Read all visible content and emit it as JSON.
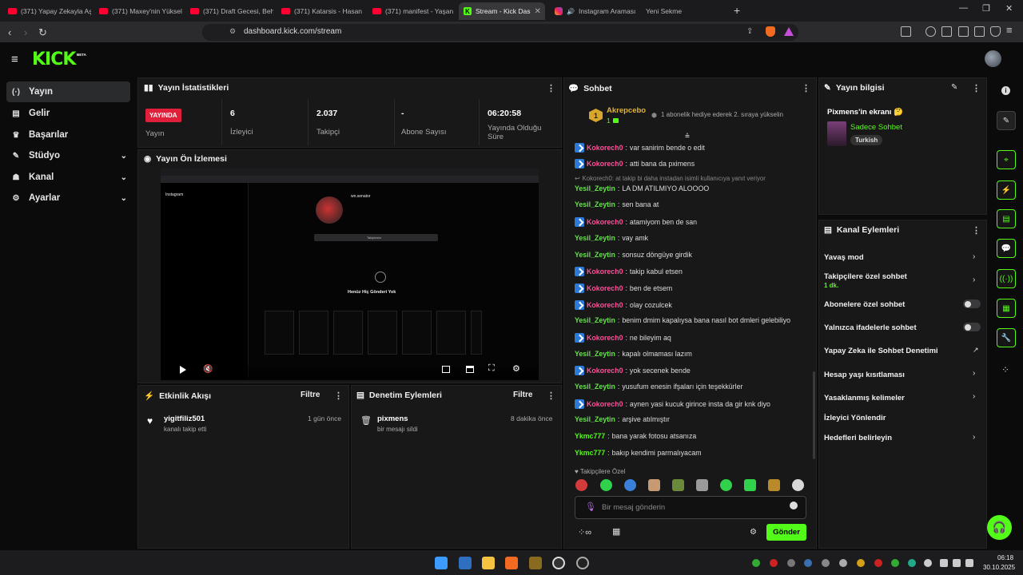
{
  "browser": {
    "tabs": [
      {
        "title": "(371) Yapay Zekayla Aş"
      },
      {
        "title": "(371) Maxey'nin Yüksel"
      },
      {
        "title": "(371) Draft Gecesi, Beh"
      },
      {
        "title": "(371) Katarsis - Hasan"
      },
      {
        "title": "(371) manifest - Yaşan"
      },
      {
        "title": "Stream - Kick Das"
      },
      {
        "title": "Instagram Araması"
      },
      {
        "title": "Yeni Sekme"
      }
    ],
    "new_tab": "+",
    "url": "dashboard.kick.com/stream"
  },
  "header": {
    "logo": "KICK",
    "beta": "BETA"
  },
  "sidebar": {
    "items": [
      {
        "label": "Yayın",
        "icon": "broadcast-icon"
      },
      {
        "label": "Gelir",
        "icon": "wallet-icon"
      },
      {
        "label": "Başarılar",
        "icon": "trophy-icon"
      },
      {
        "label": "Stüdyo",
        "icon": "studio-icon"
      },
      {
        "label": "Kanal",
        "icon": "user-icon"
      },
      {
        "label": "Ayarlar",
        "icon": "gear-icon"
      }
    ]
  },
  "stats": {
    "title": "Yayın İstatistikleri",
    "live_badge": "YAYINDA",
    "status_label": "Yayın",
    "viewers": "6",
    "viewers_label": "İzleyici",
    "followers": "2.037",
    "followers_label": "Takipçi",
    "subs": "-",
    "subs_label": "Abone Sayısı",
    "uptime": "06:20:58",
    "uptime_label": "Yayında Olduğu Süre"
  },
  "preview": {
    "title": "Yayın Ön İzlemesi",
    "profile_name": "wn.senator",
    "no_posts": "Henüz Hiç Gönderi Yok",
    "follow_btn": "Takiptesin",
    "ig_logo": "Instagram"
  },
  "activity": {
    "title": "Etkinlik Akışı",
    "filter": "Filtre",
    "user": "yigitfiliz501",
    "action": "kanalı takip etti",
    "time": "1 gün önce"
  },
  "moderation": {
    "title": "Denetim Eylemleri",
    "filter": "Filtre",
    "user": "pixmens",
    "action": "bir mesajı sildi",
    "time": "8 dakika önce"
  },
  "chat": {
    "title": "Sohbet",
    "gifter_rank": "1",
    "gifter_name": "Akrepcebo",
    "gifter_count": "1",
    "gift_notice": "1 abonelik hediye ederek 2. sıraya yükselin",
    "reply_notice": "Kokorech0: at takip bi daha instadan isimli kullanıcıya yanıt veriyor",
    "messages": [
      {
        "user": "Kokorech0",
        "text": "var sanirim bende o edit"
      },
      {
        "user": "Kokorech0",
        "text": "atti bana da pximens"
      },
      {
        "user": "Yesil_Zeytin",
        "text": "LA DM ATILMIYO ALOOOO"
      },
      {
        "user": "Yesil_Zeytin",
        "text": "sen bana at"
      },
      {
        "user": "Kokorech0",
        "text": "atamiyom ben de san"
      },
      {
        "user": "Yesil_Zeytin",
        "text": "vay amk"
      },
      {
        "user": "Yesil_Zeytin",
        "text": "sonsuz döngüye girdik"
      },
      {
        "user": "Kokorech0",
        "text": "takip kabul etsen"
      },
      {
        "user": "Kokorech0",
        "text": "ben de etsem"
      },
      {
        "user": "Kokorech0",
        "text": "olay cozulcek"
      },
      {
        "user": "Yesil_Zeytin",
        "text": "benim dmim kapalıysa bana nasıl bot dmleri gelebiliyo"
      },
      {
        "user": "Kokorech0",
        "text": "ne bileyim aq"
      },
      {
        "user": "Yesil_Zeytin",
        "text": "kapalı olmaması lazım"
      },
      {
        "user": "Kokorech0",
        "text": "yok secenek bende"
      },
      {
        "user": "Yesil_Zeytin",
        "text": "yusufum enesin ifşaları için teşekkürler"
      },
      {
        "user": "Kokorech0",
        "text": "aynen yasi kucuk girince insta da gir knk diyo"
      },
      {
        "user": "Yesil_Zeytin",
        "text": "arşive atılmıştır"
      },
      {
        "user": "Ykmc777",
        "text": "bana yarak fotosu atsanıza"
      },
      {
        "user": "Ykmc777",
        "text": "bakıp kendimi parmalıyacam"
      }
    ],
    "followers_only": "Takipçilere Özel",
    "input_placeholder": "Bir mesaj gönderin",
    "send": "Gönder"
  },
  "stream_info": {
    "title": "Yayın bilgisi",
    "screen_title": "Pixmens'in ekranı 🤔",
    "category": "Sadece Sohbet",
    "language": "Turkish"
  },
  "channel_actions": {
    "title": "Kanal Eylemleri",
    "slow_mode": "Yavaş mod",
    "followers_chat": "Takipçilere özel sohbet",
    "followers_chat_sub": "1 dk.",
    "subs_chat": "Abonelere özel sohbet",
    "emote_chat": "Yalnızca ifadelerle sohbet",
    "ai_moderation": "Yapay Zeka ile Sohbet Denetimi",
    "age_restriction": "Hesap yaşı kısıtlaması",
    "banned_words": "Yasaklanmış kelimeler",
    "raid": "İzleyici Yönlendir",
    "goals": "Hedefleri belirleyin"
  },
  "taskbar": {
    "time": "06:18",
    "date": "30.10.2025"
  },
  "colors": {
    "accent": "#53fc18",
    "live": "#e0203a",
    "panel": "#181818"
  }
}
